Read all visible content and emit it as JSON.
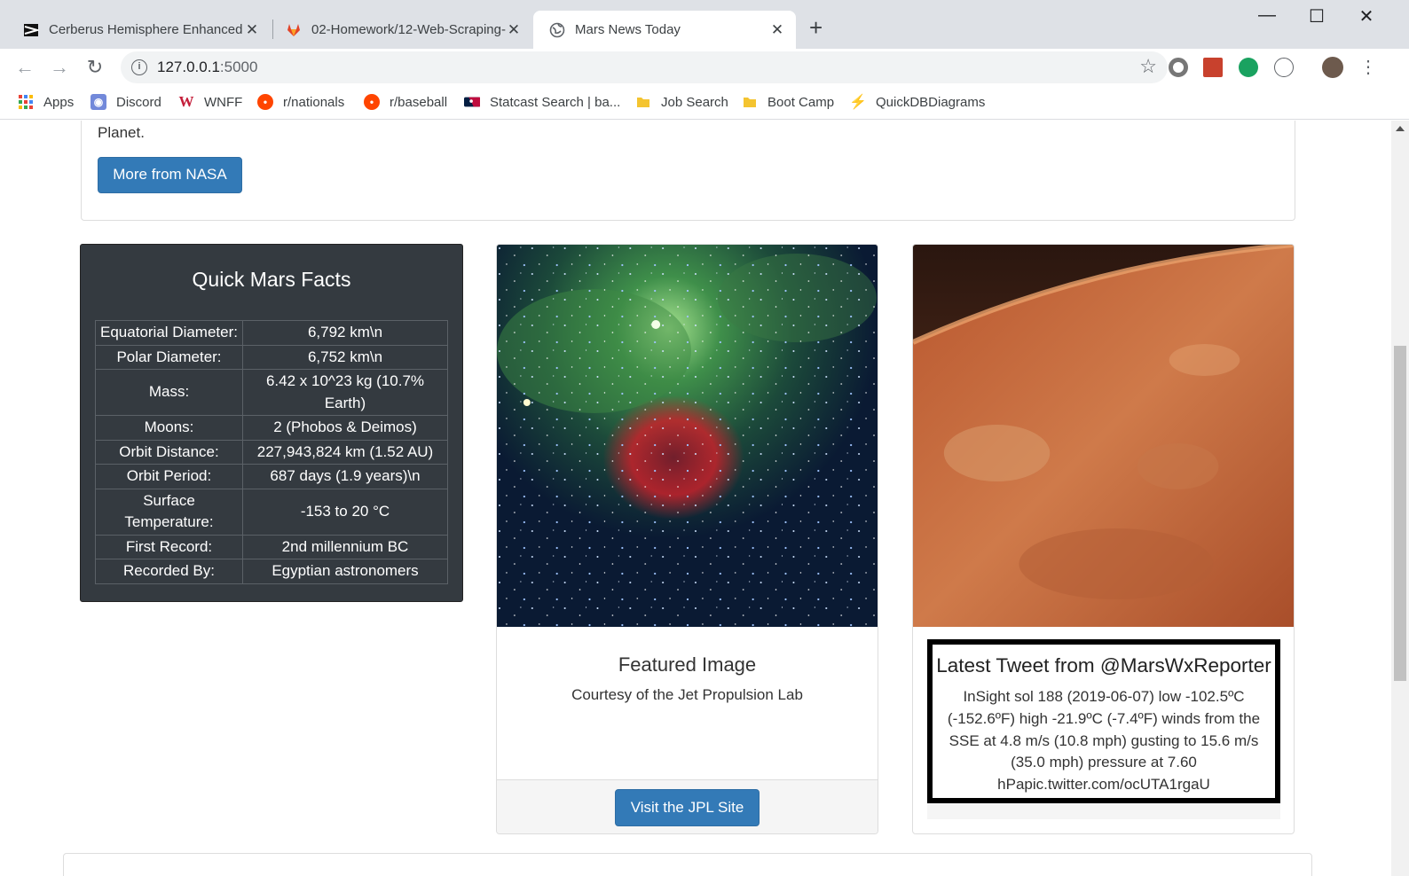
{
  "browser": {
    "tabs": [
      {
        "title": "Cerberus Hemisphere Enhanced |",
        "icon": "cerberus-favicon-icon",
        "active": false
      },
      {
        "title": "02-Homework/12-Web-Scraping-",
        "icon": "gitlab-fox-icon",
        "active": false
      },
      {
        "title": "Mars News Today",
        "icon": "globe-icon",
        "active": true
      }
    ],
    "url_host": "127.0.0.1",
    "url_port": ":5000",
    "bookmarks": [
      {
        "label": "Apps",
        "icon": "apps-grid-icon"
      },
      {
        "label": "Discord",
        "icon": "discord-icon"
      },
      {
        "label": "WNFF",
        "icon": "nationals-logo-icon"
      },
      {
        "label": "r/nationals",
        "icon": "reddit-icon"
      },
      {
        "label": "r/baseball",
        "icon": "reddit-icon"
      },
      {
        "label": "Statcast Search | ba...",
        "icon": "mlb-icon"
      },
      {
        "label": "Job Search",
        "icon": "folder-icon"
      },
      {
        "label": "Boot Camp",
        "icon": "folder-icon"
      },
      {
        "label": "QuickDBDiagrams",
        "icon": "lightning-icon"
      }
    ]
  },
  "page": {
    "news": {
      "text_tail": "Planet.",
      "button_label": "More from NASA"
    },
    "facts": {
      "title": "Quick Mars Facts",
      "rows": [
        {
          "key": "Equatorial Diameter:",
          "value": "6,792 km\\n"
        },
        {
          "key": "Polar Diameter:",
          "value": "6,752 km\\n"
        },
        {
          "key": "Mass:",
          "value": "6.42 x 10^23 kg (10.7% Earth)"
        },
        {
          "key": "Moons:",
          "value": "2 (Phobos & Deimos)"
        },
        {
          "key": "Orbit Distance:",
          "value": "227,943,824 km (1.52 AU)"
        },
        {
          "key": "Orbit Period:",
          "value": "687 days (1.9 years)\\n"
        },
        {
          "key": "Surface Temperature:",
          "value": "-153 to 20 °C"
        },
        {
          "key": "First Record:",
          "value": "2nd millennium BC"
        },
        {
          "key": "Recorded By:",
          "value": "Egyptian astronomers"
        }
      ]
    },
    "featured": {
      "title": "Featured Image",
      "subtitle": "Courtesy of the Jet Propulsion Lab",
      "button_label": "Visit the JPL Site"
    },
    "weather": {
      "title": "Latest Tweet from @MarsWxReporter",
      "tweet": "InSight sol 188 (2019-06-07) low -102.5ºC (-152.6ºF) high -21.9ºC (-7.4ºF) winds from the SSE at 4.8 m/s (10.8 mph) gusting to 15.6 m/s (35.0 mph) pressure at 7.60 hPapic.twitter.com/ocUTA1rgaU"
    }
  },
  "colors": {
    "button_blue": "#337ab7",
    "facts_bg": "#343a40",
    "chrome_tabstrip": "#dee1e6"
  }
}
